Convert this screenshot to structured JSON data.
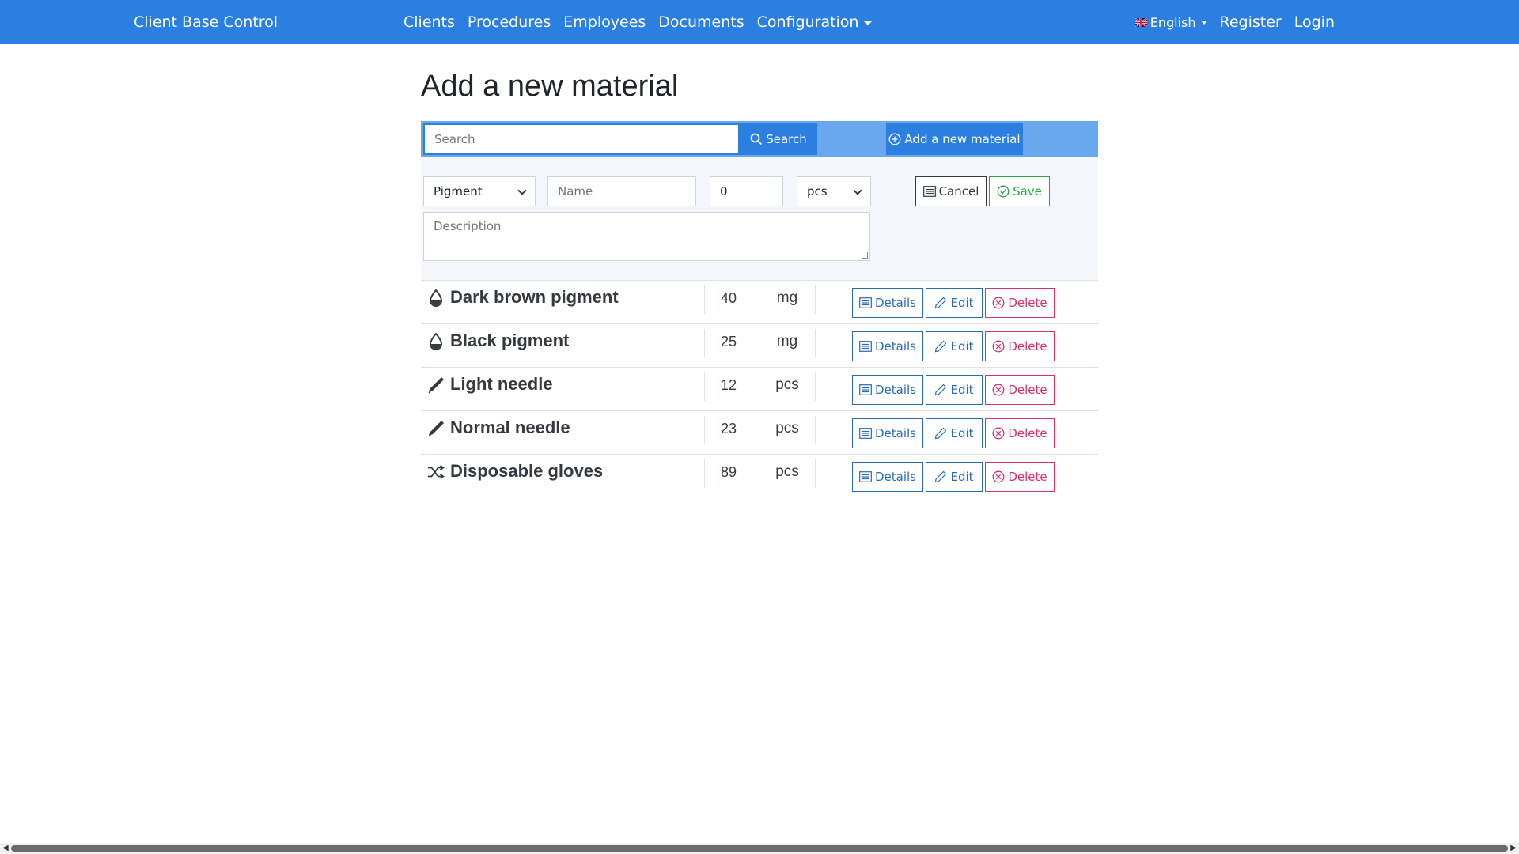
{
  "navbar": {
    "brand": "Client Base Control",
    "links": [
      "Clients",
      "Procedures",
      "Employees",
      "Documents",
      "Configuration"
    ],
    "language": "English",
    "register": "Register",
    "login": "Login"
  },
  "page": {
    "title": "Add a new material"
  },
  "search": {
    "placeholder": "Search",
    "button": "Search",
    "add_button": "Add a new material"
  },
  "form": {
    "type_value": "Pigment",
    "name_placeholder": "Name",
    "quantity_value": "0",
    "unit_value": "pcs",
    "description_placeholder": "Description",
    "cancel": "Cancel",
    "save": "Save"
  },
  "materials": [
    {
      "icon": "droplet-icon",
      "name": "Dark brown pigment",
      "quantity": "40",
      "unit": "mg"
    },
    {
      "icon": "droplet-icon",
      "name": "Black pigment",
      "quantity": "25",
      "unit": "mg"
    },
    {
      "icon": "needle-icon",
      "name": "Light needle",
      "quantity": "12",
      "unit": "pcs"
    },
    {
      "icon": "needle-icon",
      "name": "Normal needle",
      "quantity": "23",
      "unit": "pcs"
    },
    {
      "icon": "shuffle-icon",
      "name": "Disposable gloves",
      "quantity": "89",
      "unit": "pcs"
    }
  ],
  "row_actions": {
    "details": "Details",
    "edit": "Edit",
    "delete": "Delete"
  },
  "colors": {
    "primary": "#2b7fe0",
    "danger": "#d6336c",
    "success": "#28a745"
  }
}
